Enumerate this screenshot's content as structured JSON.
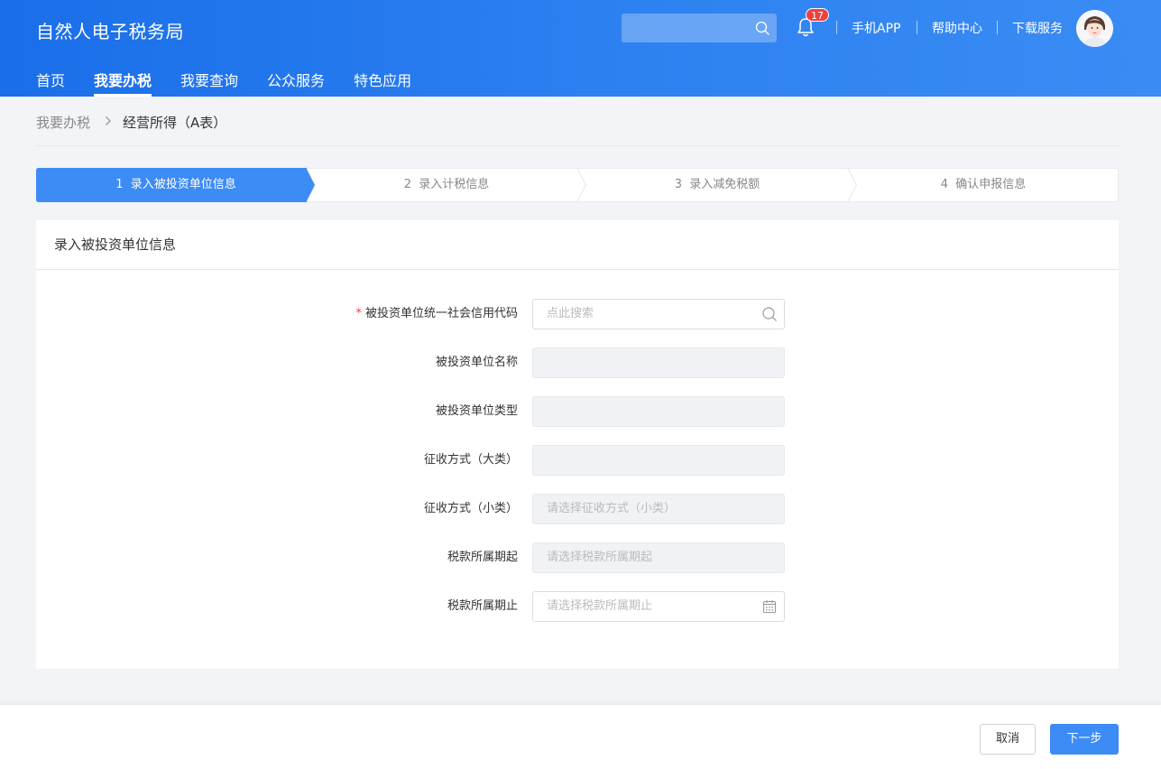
{
  "header": {
    "logo": "自然人电子税务局",
    "notification_count": "17",
    "links": [
      "手机APP",
      "帮助中心",
      "下载服务"
    ]
  },
  "nav": [
    "首页",
    "我要办税",
    "我要查询",
    "公众服务",
    "特色应用"
  ],
  "nav_active": "我要办税",
  "breadcrumb": {
    "parent": "我要办税",
    "current": "经营所得（A表）"
  },
  "steps": [
    {
      "num": "1",
      "label": "录入被投资单位信息",
      "active": true
    },
    {
      "num": "2",
      "label": "录入计税信息",
      "active": false
    },
    {
      "num": "3",
      "label": "录入减免税额",
      "active": false
    },
    {
      "num": "4",
      "label": "确认申报信息",
      "active": false
    }
  ],
  "card": {
    "title": "录入被投资单位信息",
    "fields": [
      {
        "label": "被投资单位统一社会信用代码",
        "required": true,
        "placeholder": "点此搜索",
        "state": "editable",
        "icon": "search-icon"
      },
      {
        "label": "被投资单位名称",
        "required": false,
        "placeholder": "",
        "state": "disabled",
        "icon": ""
      },
      {
        "label": "被投资单位类型",
        "required": false,
        "placeholder": "",
        "state": "disabled",
        "icon": ""
      },
      {
        "label": "征收方式（大类）",
        "required": false,
        "placeholder": "",
        "state": "disabled",
        "icon": ""
      },
      {
        "label": "征收方式（小类）",
        "required": false,
        "placeholder": "请选择征收方式（小类）",
        "state": "disabled",
        "icon": ""
      },
      {
        "label": "税款所属期起",
        "required": false,
        "placeholder": "请选择税款所属期起",
        "state": "disabled",
        "icon": ""
      },
      {
        "label": "税款所属期止",
        "required": false,
        "placeholder": "请选择税款所属期止",
        "state": "editable",
        "icon": "calendar-icon"
      }
    ]
  },
  "footer": {
    "cancel_label": "取消",
    "next_label": "下一步"
  },
  "colors": {
    "primary": "#3d8bf5",
    "header_start": "#1a6ee9",
    "header_end": "#3a8cf4",
    "badge": "#f0413c"
  }
}
